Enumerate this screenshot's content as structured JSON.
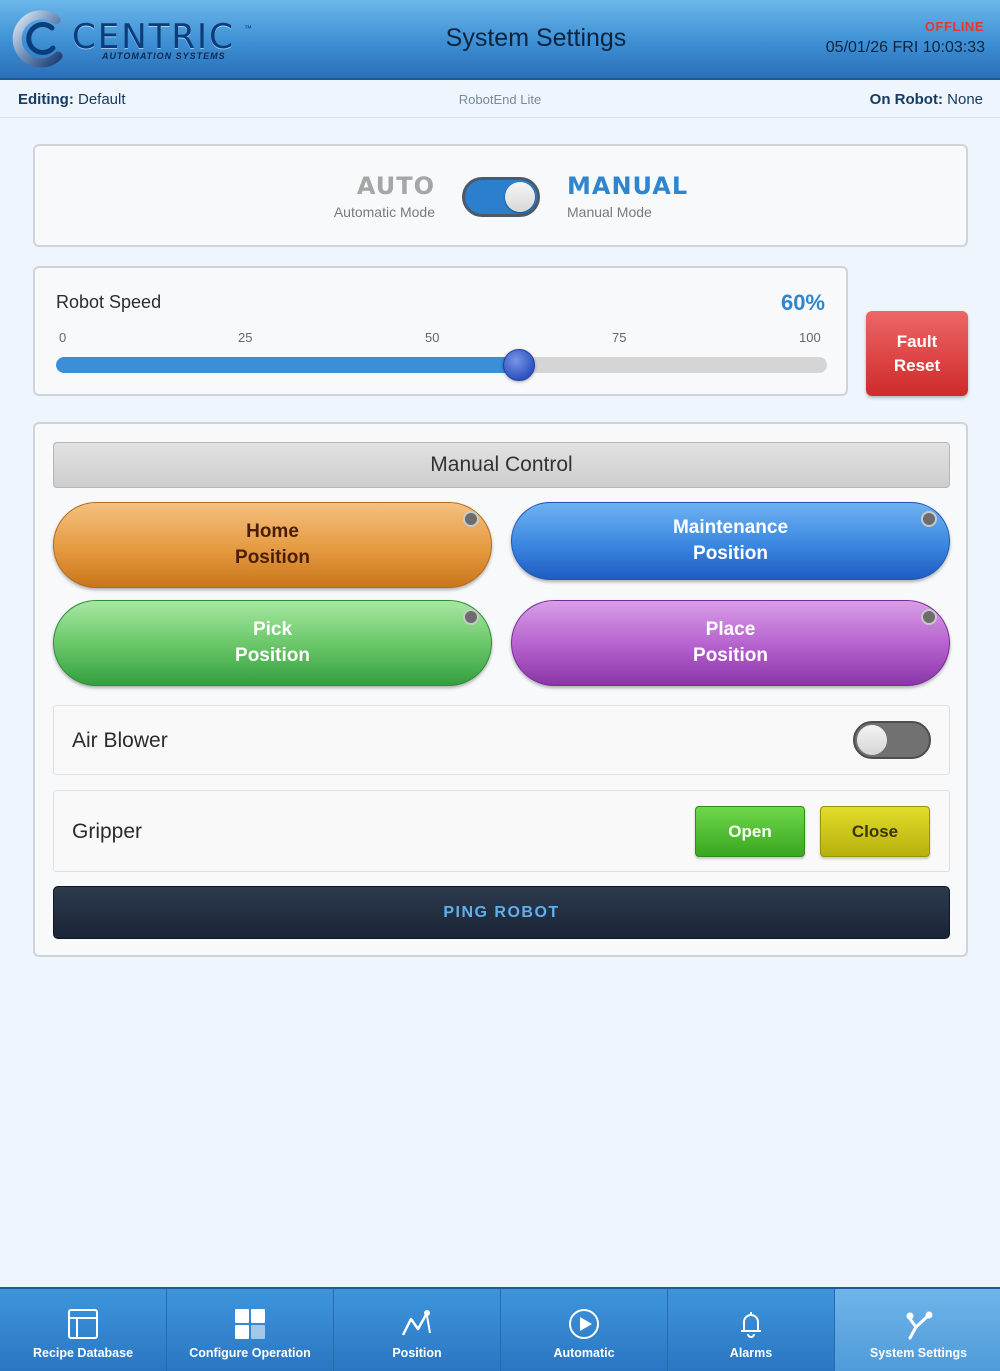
{
  "header": {
    "logo_text": "CENTRIC",
    "logo_tm": "™",
    "logo_sub": "AUTOMATION SYSTEMS",
    "title": "System Settings",
    "connection_status": "OFFLINE",
    "datetime": "05/01/26 FRI 10:03:33"
  },
  "subbar": {
    "editing_label": "Editing:",
    "editing_value": "Default",
    "product": "RobotEnd Lite",
    "on_robot_label": "On Robot:",
    "on_robot_value": "None"
  },
  "mode": {
    "auto_label": "AUTO",
    "auto_sub": "Automatic Mode",
    "manual_label": "MANUAL",
    "manual_sub": "Manual Mode",
    "selected": "MANUAL"
  },
  "speed": {
    "label": "Robot Speed",
    "value_text": "60%",
    "value": 60,
    "ticks": [
      "0",
      "25",
      "50",
      "75",
      "100"
    ]
  },
  "fault_reset": {
    "label": "Fault\nReset"
  },
  "manual_control": {
    "title": "Manual Control",
    "positions": [
      {
        "label": "Home\nPosition"
      },
      {
        "label": "Maintenance\nPosition"
      },
      {
        "label": "Pick\nPosition"
      },
      {
        "label": "Place\nPosition"
      }
    ],
    "air_blower": {
      "label": "Air Blower",
      "on": false
    },
    "gripper": {
      "label": "Gripper",
      "open_label": "Open",
      "close_label": "Close"
    },
    "ping_label": "PING ROBOT"
  },
  "nav": {
    "items": [
      {
        "label": "Recipe Database",
        "icon": "recipe-database-icon"
      },
      {
        "label": "Configure Operation",
        "icon": "configure-operation-icon"
      },
      {
        "label": "Position",
        "icon": "position-icon"
      },
      {
        "label": "Automatic",
        "icon": "automatic-icon"
      },
      {
        "label": "Alarms",
        "icon": "alarm-bell-icon"
      },
      {
        "label": "System Settings",
        "icon": "system-settings-icon"
      }
    ],
    "active": "System Settings"
  },
  "colors": {
    "header_blue": "#3d8fd4",
    "accent": "#2f86cf",
    "offline": "#e8352e",
    "fault": "#cf2a2a"
  }
}
